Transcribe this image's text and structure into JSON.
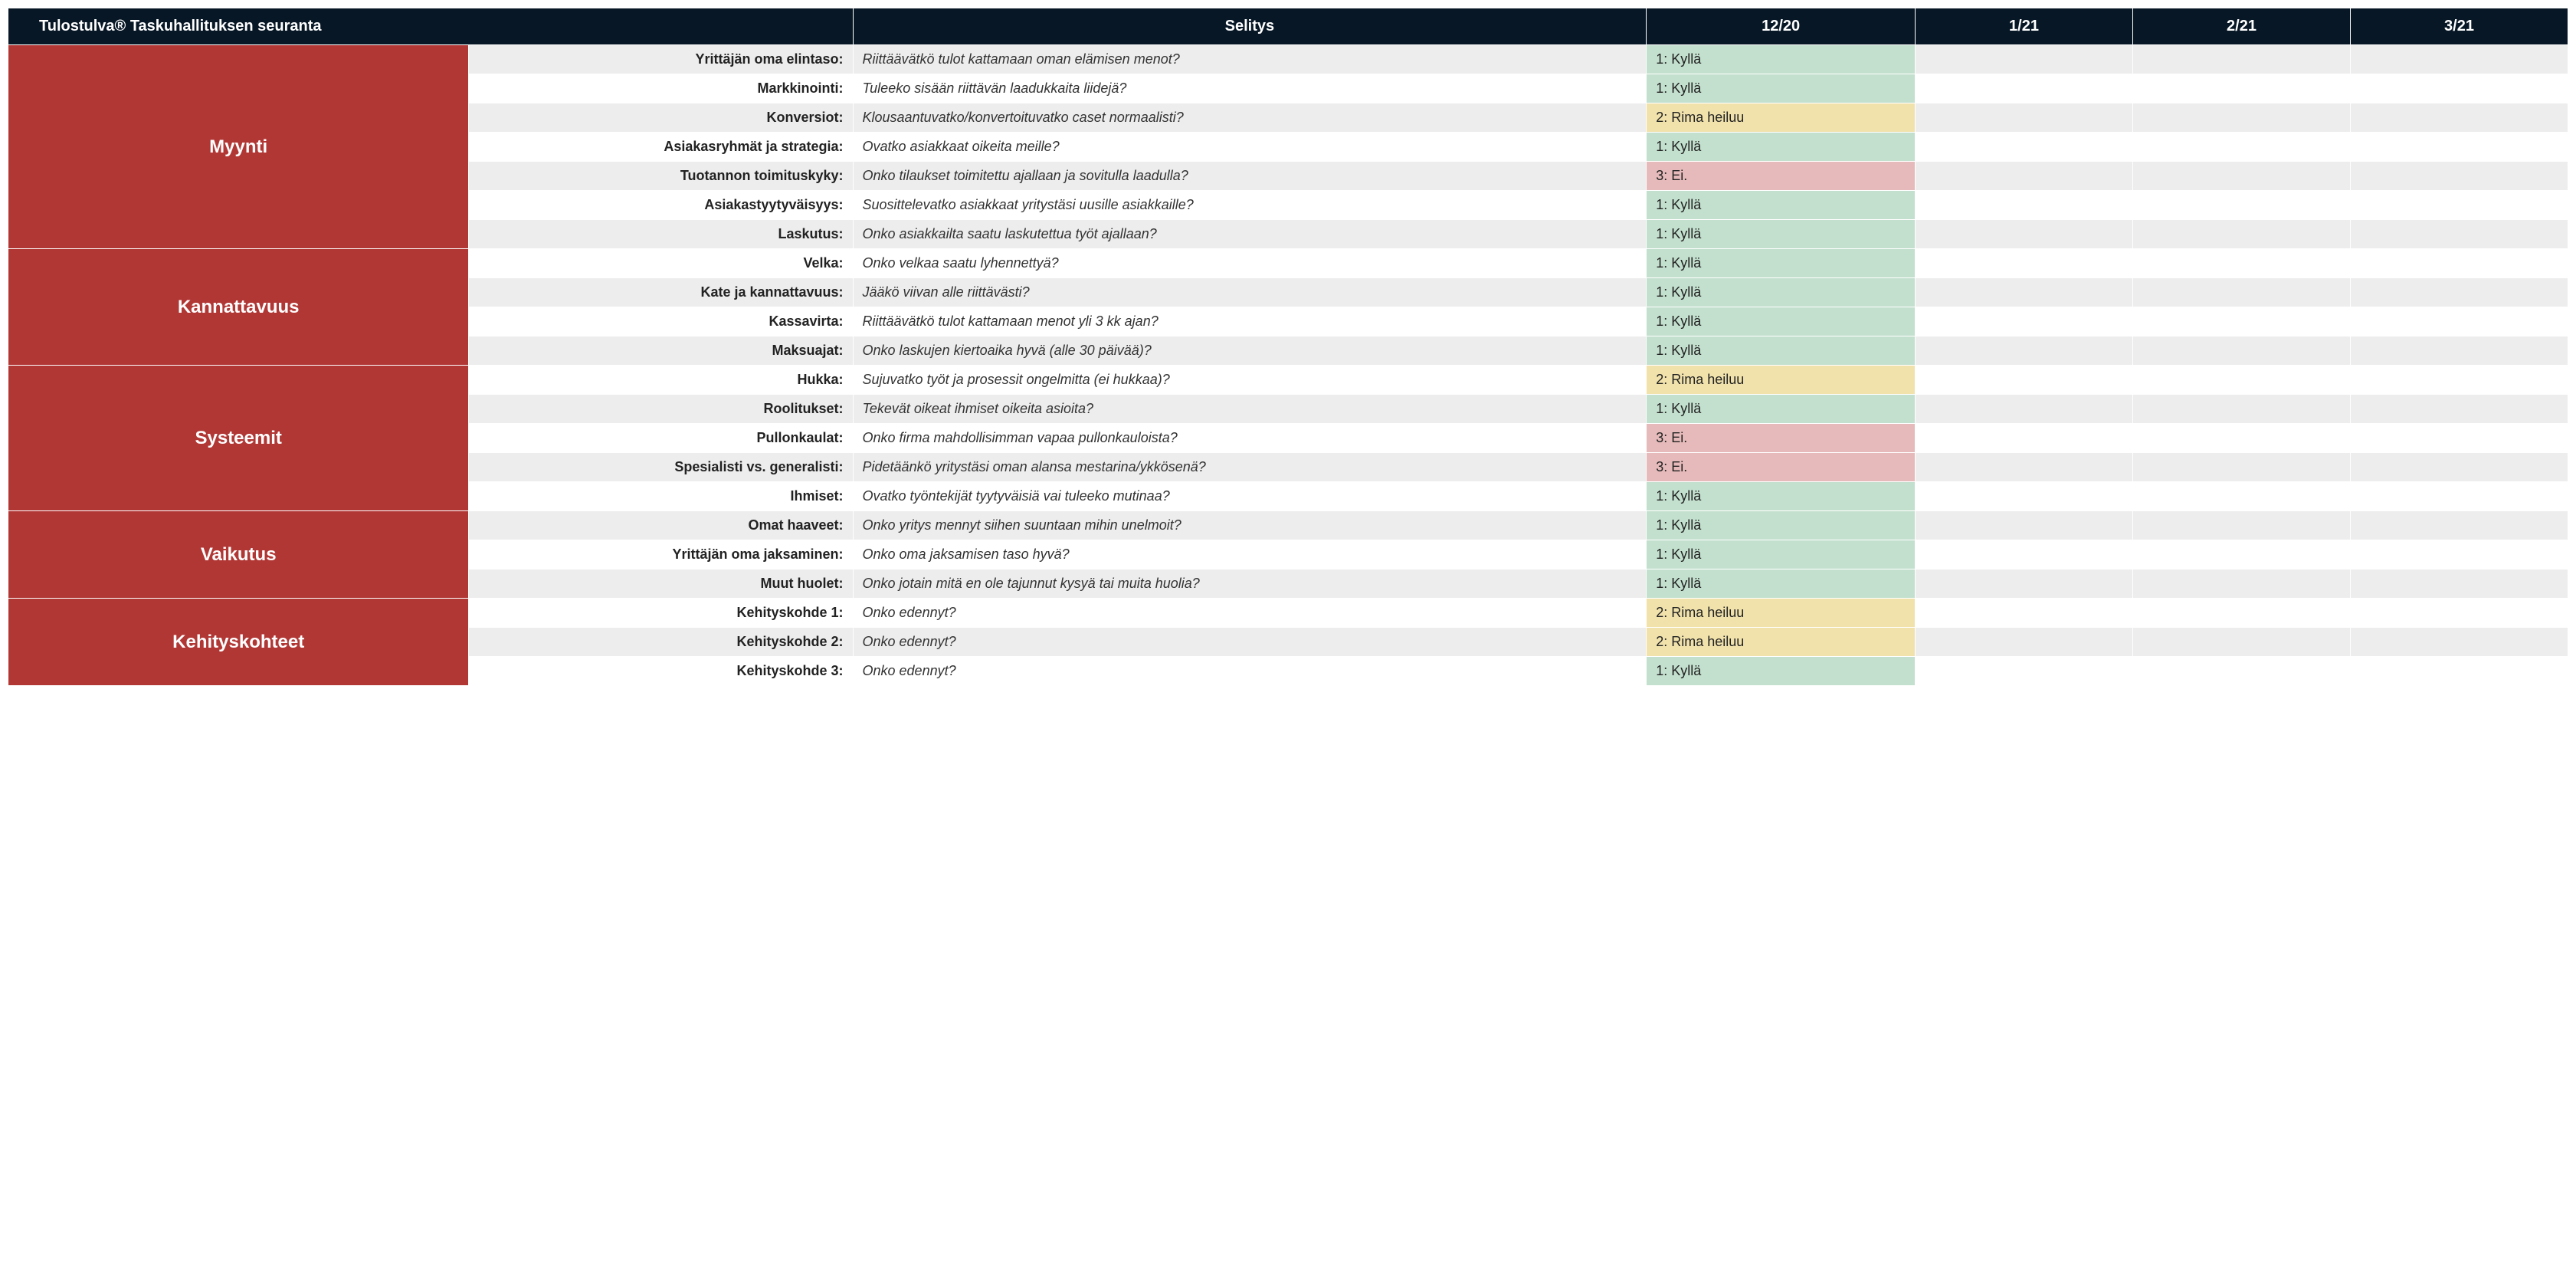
{
  "header": {
    "title": "Tulostulva® Taskuhallituksen seuranta",
    "desc_col": "Selitys",
    "periods": [
      "12/20",
      "1/21",
      "2/21",
      "3/21"
    ]
  },
  "status_map": {
    "1": {
      "label": "1: Kyllä",
      "class": "status-green"
    },
    "2": {
      "label": "2: Rima heiluu",
      "class": "status-yellow"
    },
    "3": {
      "label": "3: Ei.",
      "class": "status-red"
    }
  },
  "categories": [
    {
      "name": "Myynti",
      "rows": [
        {
          "label": "Yrittäjän oma elintaso:",
          "desc": "Riittäävätkö tulot kattamaan oman elämisen menot?",
          "values": [
            "1",
            "",
            "",
            ""
          ]
        },
        {
          "label": "Markkinointi:",
          "desc": "Tuleeko sisään riittävän laadukkaita liidejä?",
          "values": [
            "1",
            "",
            "",
            ""
          ]
        },
        {
          "label": "Konversiot:",
          "desc": "Klousaantuvatko/konvertoituvatko caset normaalisti?",
          "values": [
            "2",
            "",
            "",
            ""
          ]
        },
        {
          "label": "Asiakasryhmät ja strategia:",
          "desc": "Ovatko asiakkaat oikeita meille?",
          "values": [
            "1",
            "",
            "",
            ""
          ]
        },
        {
          "label": "Tuotannon toimituskyky:",
          "desc": "Onko tilaukset toimitettu ajallaan ja sovitulla laadulla?",
          "values": [
            "3",
            "",
            "",
            ""
          ]
        },
        {
          "label": "Asiakastyytyväisyys:",
          "desc": "Suosittelevatko asiakkaat yritystäsi uusille asiakkaille?",
          "values": [
            "1",
            "",
            "",
            ""
          ]
        },
        {
          "label": "Laskutus:",
          "desc": "Onko asiakkailta saatu laskutettua työt ajallaan?",
          "values": [
            "1",
            "",
            "",
            ""
          ]
        }
      ]
    },
    {
      "name": "Kannattavuus",
      "rows": [
        {
          "label": "Velka:",
          "desc": "Onko velkaa saatu lyhennettyä?",
          "values": [
            "1",
            "",
            "",
            ""
          ]
        },
        {
          "label": "Kate ja kannattavuus:",
          "desc": "Jääkö viivan alle riittävästi?",
          "values": [
            "1",
            "",
            "",
            ""
          ]
        },
        {
          "label": "Kassavirta:",
          "desc": "Riittäävätkö tulot kattamaan menot yli 3 kk ajan?",
          "values": [
            "1",
            "",
            "",
            ""
          ]
        },
        {
          "label": "Maksuajat:",
          "desc": "Onko laskujen kiertoaika hyvä (alle 30 päivää)?",
          "values": [
            "1",
            "",
            "",
            ""
          ]
        }
      ]
    },
    {
      "name": "Systeemit",
      "rows": [
        {
          "label": "Hukka:",
          "desc": "Sujuvatko työt ja prosessit ongelmitta (ei hukkaa)?",
          "values": [
            "2",
            "",
            "",
            ""
          ]
        },
        {
          "label": "Roolitukset:",
          "desc": "Tekevät oikeat ihmiset oikeita asioita?",
          "values": [
            "1",
            "",
            "",
            ""
          ]
        },
        {
          "label": "Pullonkaulat:",
          "desc": "Onko firma mahdollisimman vapaa pullonkauloista?",
          "values": [
            "3",
            "",
            "",
            ""
          ]
        },
        {
          "label": "Spesialisti vs. generalisti:",
          "desc": "Pidetäänkö yritystäsi oman alansa mestarina/ykkösenä?",
          "values": [
            "3",
            "",
            "",
            ""
          ]
        },
        {
          "label": "Ihmiset:",
          "desc": "Ovatko työntekijät tyytyväisiä vai tuleeko mutinaa?",
          "values": [
            "1",
            "",
            "",
            ""
          ]
        }
      ]
    },
    {
      "name": "Vaikutus",
      "rows": [
        {
          "label": "Omat haaveet:",
          "desc": "Onko yritys mennyt siihen suuntaan mihin unelmoit?",
          "values": [
            "1",
            "",
            "",
            ""
          ]
        },
        {
          "label": "Yrittäjän oma jaksaminen:",
          "desc": "Onko oma jaksamisen taso hyvä?",
          "values": [
            "1",
            "",
            "",
            ""
          ]
        },
        {
          "label": "Muut huolet:",
          "desc": "Onko jotain mitä en ole tajunnut kysyä tai muita huolia?",
          "values": [
            "1",
            "",
            "",
            ""
          ]
        }
      ]
    },
    {
      "name": "Kehityskohteet",
      "rows": [
        {
          "label": "Kehityskohde 1:",
          "desc": "Onko edennyt?",
          "values": [
            "2",
            "",
            "",
            ""
          ]
        },
        {
          "label": "Kehityskohde 2:",
          "desc": "Onko edennyt?",
          "values": [
            "2",
            "",
            "",
            ""
          ]
        },
        {
          "label": "Kehityskohde 3:",
          "desc": "Onko edennyt?",
          "values": [
            "1",
            "",
            "",
            ""
          ]
        }
      ]
    }
  ]
}
